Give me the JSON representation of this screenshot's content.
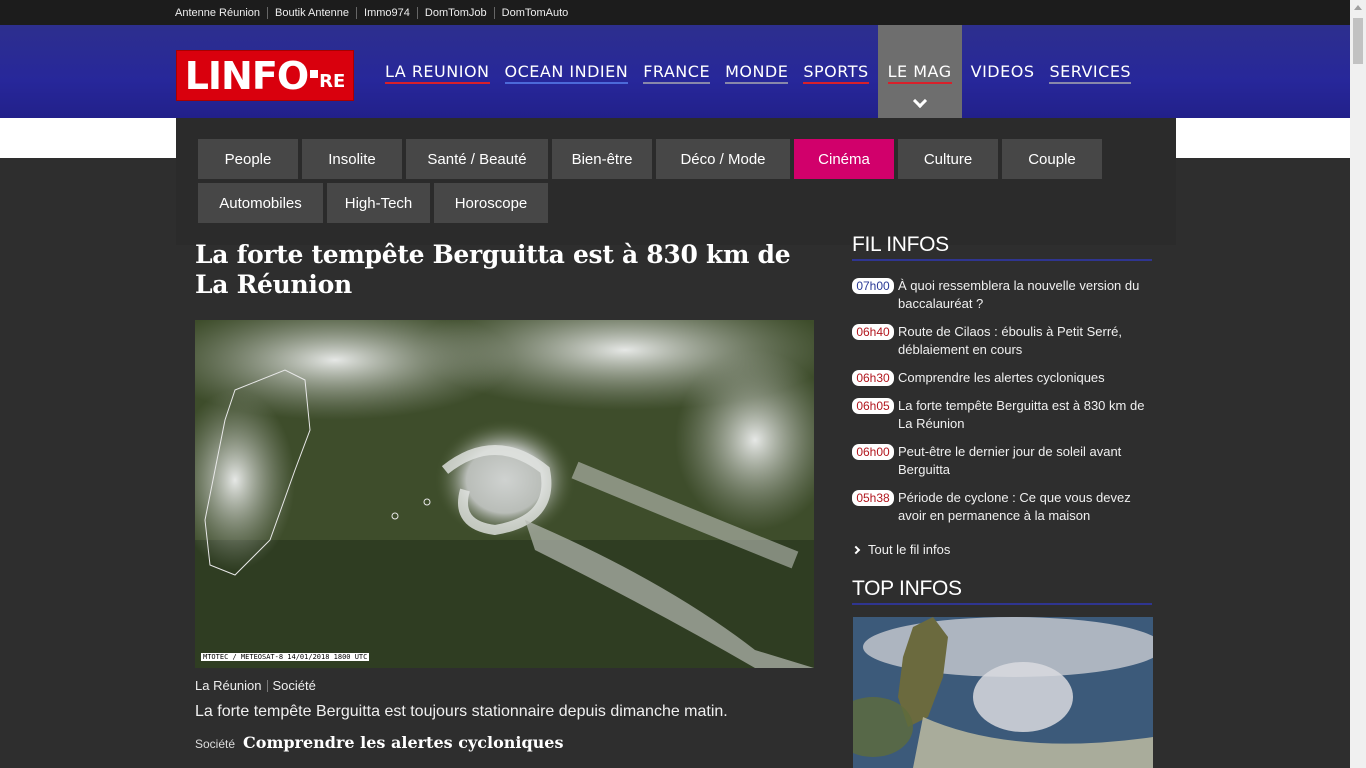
{
  "topbar": {
    "links": [
      "Antenne Réunion",
      "Boutik Antenne",
      "Immo974",
      "DomTomJob",
      "DomTomAuto"
    ]
  },
  "logo": {
    "main": "LINFO",
    "suffix": "RE"
  },
  "nav": {
    "items": [
      "LA REUNION",
      "OCEAN INDIEN",
      "FRANCE",
      "MONDE",
      "SPORTS",
      "LE MAG",
      "VIDEOS",
      "SERVICES"
    ],
    "active": "LE MAG"
  },
  "megamenu": {
    "row1": [
      "People",
      "Insolite",
      "Santé / Beauté",
      "Bien-être",
      "Déco / Mode",
      "Cinéma",
      "Culture",
      "Couple"
    ],
    "row2": [
      "Automobiles",
      "High-Tech",
      "Horoscope"
    ],
    "active": "Cinéma"
  },
  "article": {
    "title": "La forte tempête Berguitta est à 830 km de La Réunion",
    "photo_credit": "MTOTEC / METEOSAT-8 14/01/2018 1800 UTC",
    "tags": [
      "La Réunion",
      "Société"
    ],
    "lead": "La forte tempête Berguitta est toujours stationnaire depuis dimanche matin.",
    "related": [
      {
        "category": "Société",
        "title": "Comprendre les alertes cycloniques"
      }
    ]
  },
  "sidebar": {
    "fil_title": "FIL INFOS",
    "fil": [
      {
        "time": "07h00",
        "text": "À quoi ressemblera la nouvelle version du baccalauréat ?"
      },
      {
        "time": "06h40",
        "text": "Route de Cilaos : éboulis à Petit Serré, déblaiement en cours"
      },
      {
        "time": "06h30",
        "text": "Comprendre les alertes cycloniques"
      },
      {
        "time": "06h05",
        "text": "La forte tempête Berguitta est à 830 km de La Réunion"
      },
      {
        "time": "06h00",
        "text": "Peut-être le dernier jour de soleil avant Berguitta"
      },
      {
        "time": "05h38",
        "text": "Période de cyclone : Ce que vous devez avoir en permanence à la maison"
      }
    ],
    "all_fil": "Tout le fil infos",
    "top_title": "TOP INFOS"
  }
}
